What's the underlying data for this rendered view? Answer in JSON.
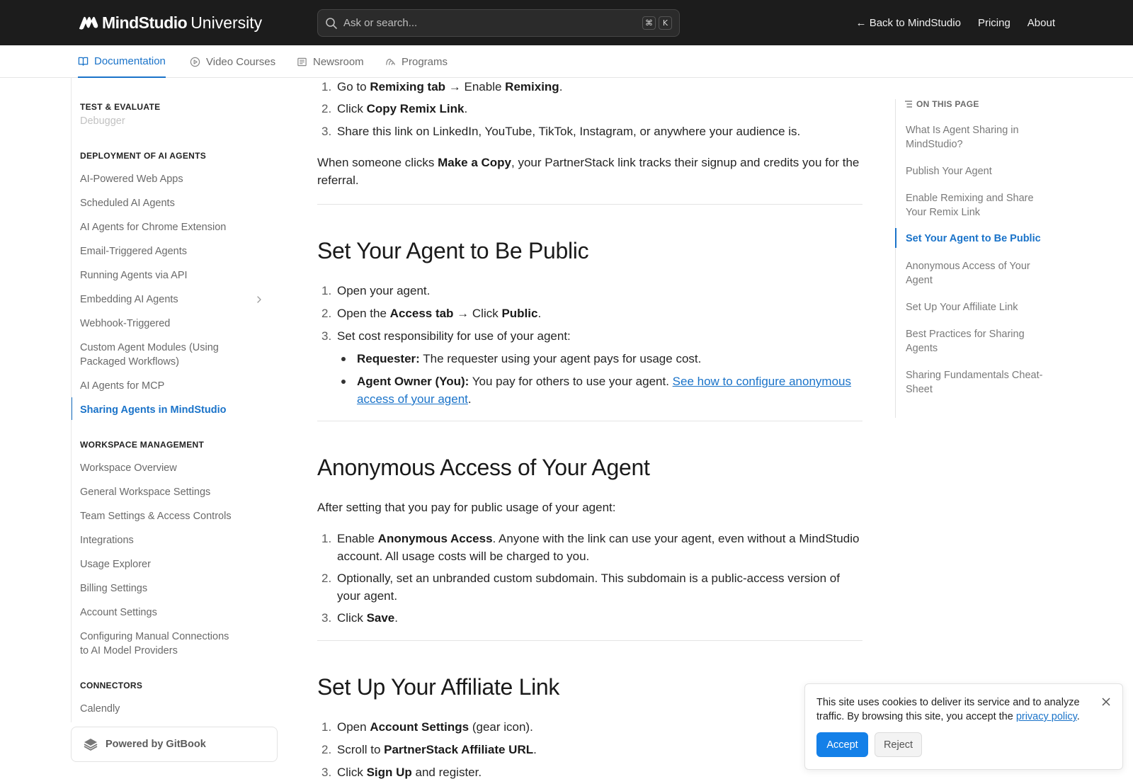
{
  "header": {
    "brand": "MindStudio",
    "brand_suffix": "University",
    "search_placeholder": "Ask or search...",
    "shortcut_keys": [
      "⌘",
      "K"
    ],
    "links": [
      "← Back to MindStudio",
      "Pricing",
      "About"
    ]
  },
  "tabs": [
    {
      "label": "Documentation",
      "icon": "book-icon",
      "active": true
    },
    {
      "label": "Video Courses",
      "icon": "play-circle-icon",
      "active": false
    },
    {
      "label": "Newsroom",
      "icon": "newspaper-icon",
      "active": false
    },
    {
      "label": "Programs",
      "icon": "programs-icon",
      "active": false
    }
  ],
  "sidebar": {
    "sections": [
      {
        "title": "TEST & EVALUATE",
        "items": [
          "Debugger"
        ]
      },
      {
        "title": "DEPLOYMENT OF AI AGENTS",
        "items": [
          "AI-Powered Web Apps",
          "Scheduled AI Agents",
          "AI Agents for Chrome Extension",
          "Email-Triggered Agents",
          "Running Agents via API",
          "Embedding AI Agents",
          "Webhook-Triggered",
          "Custom Agent Modules (Using Packaged Workflows)",
          "AI Agents for MCP",
          "Sharing Agents in MindStudio"
        ]
      },
      {
        "title": "WORKSPACE MANAGEMENT",
        "items": [
          "Workspace Overview",
          "General Workspace Settings",
          "Team Settings & Access Controls",
          "Integrations",
          "Usage Explorer",
          "Billing Settings",
          "Account Settings",
          "Configuring Manual Connections to AI Model Providers"
        ]
      },
      {
        "title": "CONNECTORS",
        "items": [
          "Calendly"
        ]
      }
    ],
    "active_item": "Sharing Agents in MindStudio",
    "powered_by": "Powered by GitBook"
  },
  "content": {
    "remix_steps": [
      {
        "num": "1.",
        "p1": "Go to ",
        "b1": "Remixing tab",
        "p2": " → Enable ",
        "b2": "Remixing",
        "p3": "."
      },
      {
        "num": "2.",
        "p1": "Click ",
        "b1": "Copy Remix Link",
        "p2": "."
      },
      {
        "num": "3.",
        "text": "Share this link on LinkedIn, YouTube, TikTok, Instagram, or anywhere your audience is."
      }
    ],
    "remix_note": {
      "p1": "When someone clicks ",
      "b1": "Make a Copy",
      "p2": ", your PartnerStack link tracks their signup and credits you for the referral."
    },
    "public_heading": "Set Your Agent to Be Public",
    "public_steps": [
      {
        "num": "1.",
        "text": "Open your agent."
      },
      {
        "num": "2.",
        "p1": "Open the ",
        "b1": "Access tab",
        "p2": " → Click ",
        "b2": "Public",
        "p3": "."
      },
      {
        "num": "3.",
        "text": "Set cost responsibility for use of your agent:"
      }
    ],
    "public_bullets": [
      {
        "b1": "Requester:",
        "p1": " The requester using your agent pays for usage cost."
      },
      {
        "b1": "Agent Owner (You):",
        "p1": " You pay for others to use your agent. ",
        "link": "See how to configure anonymous access of your agent",
        "p2": "."
      }
    ],
    "anon_heading": "Anonymous Access of Your Agent",
    "anon_intro": "After setting that you pay for public usage of your agent:",
    "anon_steps": [
      {
        "num": "1.",
        "p1": "Enable ",
        "b1": "Anonymous Access",
        "p2": ". Anyone with the link can use your agent, even without a MindStudio account. All usage costs will be charged to you."
      },
      {
        "num": "2.",
        "text": "Optionally, set an unbranded custom subdomain. This subdomain is a public-access version of your agent."
      },
      {
        "num": "3.",
        "p1": "Click ",
        "b1": "Save",
        "p2": "."
      }
    ],
    "affiliate_heading": "Set Up Your Affiliate Link",
    "affiliate_steps": [
      {
        "num": "1.",
        "p1": "Open ",
        "b1": "Account Settings",
        "p2": " (gear icon)."
      },
      {
        "num": "2.",
        "p1": "Scroll to ",
        "b1": "PartnerStack Affiliate URL",
        "p2": "."
      },
      {
        "num": "3.",
        "p1": "Click ",
        "b1": "Sign Up",
        "p2": " and register."
      }
    ]
  },
  "toc": {
    "title": "ON THIS PAGE",
    "items": [
      "What Is Agent Sharing in MindStudio?",
      "Publish Your Agent",
      "Enable Remixing and Share Your Remix Link",
      "Set Your Agent to Be Public",
      "Anonymous Access of Your Agent",
      "Set Up Your Affiliate Link",
      "Best Practices for Sharing Agents",
      "Sharing Fundamentals Cheat-Sheet"
    ],
    "active_item": "Set Your Agent to Be Public"
  },
  "cookie": {
    "text": "This site uses cookies to deliver its service and to analyze traffic. By browsing this site, you accept the ",
    "link": "privacy policy",
    "end": ".",
    "accept": "Accept",
    "reject": "Reject"
  },
  "colors": {
    "topbar": "#1c1c1c",
    "accent": "#1a73c9",
    "accept_button": "#1480e8"
  }
}
